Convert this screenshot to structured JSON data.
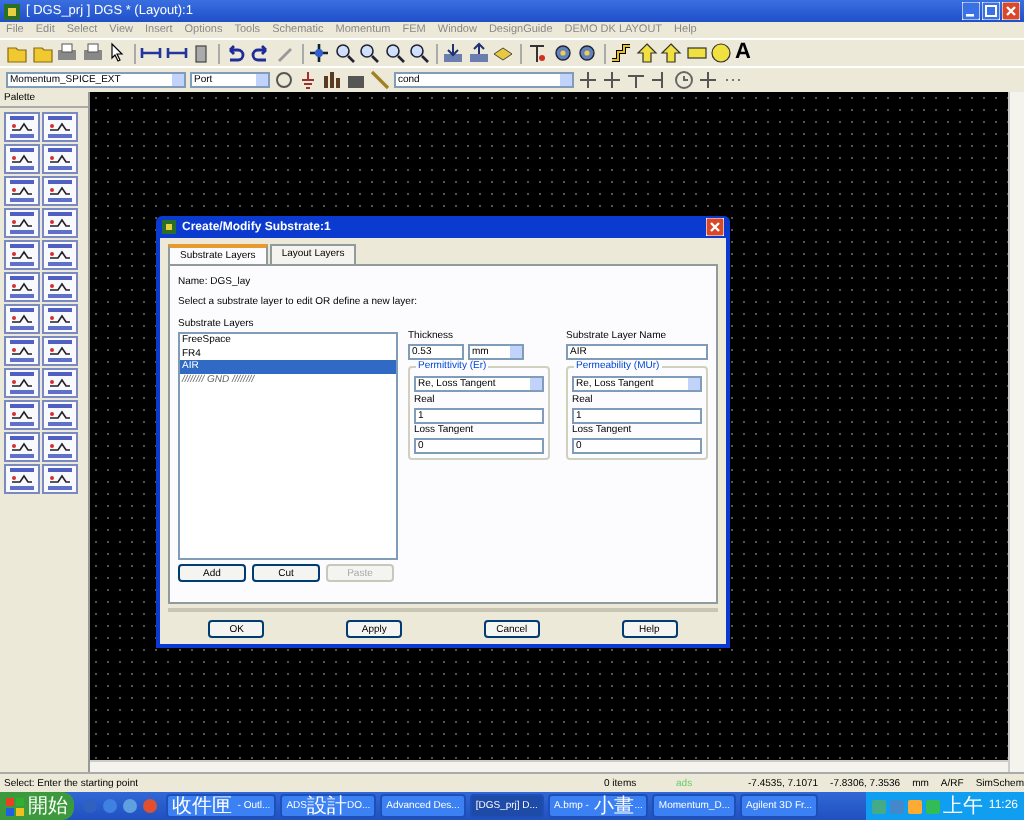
{
  "window": {
    "title": "[ DGS_prj ] DGS * (Layout):1"
  },
  "menu": [
    "File",
    "Edit",
    "Select",
    "View",
    "Insert",
    "Options",
    "Tools",
    "Schematic",
    "Momentum",
    "FEM",
    "Window",
    "DesignGuide",
    "DEMO DK LAYOUT",
    "Help"
  ],
  "toolbar": {
    "text_tool": "A"
  },
  "layout_toolbar": {
    "library": "Momentum_SPICE_EXT",
    "component": "Port",
    "layer": "cond"
  },
  "palette": {
    "title": "Palette"
  },
  "dialog": {
    "title": "Create/Modify Substrate:1",
    "tabs": [
      {
        "label": "Substrate Layers",
        "selected": true
      },
      {
        "label": "Layout Layers",
        "selected": false
      }
    ],
    "name": "Name: DGS_lay",
    "instruction": "Select a substrate layer to edit OR define a new layer:",
    "list_label": "Substrate Layers",
    "layers": [
      {
        "label": "FreeSpace",
        "kind": "layer",
        "selected": false
      },
      {
        "label": "FR4",
        "kind": "layer",
        "selected": false
      },
      {
        "label": "AIR",
        "kind": "layer",
        "selected": true
      },
      {
        "label": "//////// GND ////////",
        "kind": "ground",
        "selected": false
      }
    ],
    "list_buttons": [
      {
        "label": "Add",
        "disabled": false
      },
      {
        "label": "Cut",
        "disabled": false
      },
      {
        "label": "Paste",
        "disabled": true
      }
    ],
    "thickness_label": "Thickness",
    "thickness": "0.53",
    "unit": "mm",
    "layer_name_label": "Substrate Layer Name",
    "layer_name": "AIR",
    "groups": [
      {
        "title": "Permittivity (Er)",
        "mode": "Re, Loss Tangent",
        "real_label": "Real",
        "real": "1",
        "loss_label": "Loss Tangent",
        "loss": "0"
      },
      {
        "title": "Permeability (MUr)",
        "mode": "Re, Loss Tangent",
        "real_label": "Real",
        "real": "1",
        "loss_label": "Loss Tangent",
        "loss": "0"
      }
    ],
    "buttons": [
      "OK",
      "Apply",
      "Cancel",
      "Help"
    ]
  },
  "status_bar": [
    "Select: Enter the starting point",
    "0 items",
    "ads",
    "-7.4535, 7.1071",
    "-7.8306, 7.3536",
    "mm",
    "A/RF",
    "SimSchem"
  ],
  "taskbar": {
    "start": "開始",
    "buttons": [
      {
        "label": "收件匣 - Outl...",
        "selected": false
      },
      {
        "label": "ADS設計DO...",
        "selected": false
      },
      {
        "label": "Advanced Des...",
        "selected": false
      },
      {
        "label": "[DGS_prj] D...",
        "selected": true
      },
      {
        "label": "A.bmp - 小畫...",
        "selected": false
      },
      {
        "label": "Momentum_D...",
        "selected": false
      },
      {
        "label": "Agilent 3D Fr...",
        "selected": false
      }
    ],
    "clock": "上午 11:26"
  }
}
